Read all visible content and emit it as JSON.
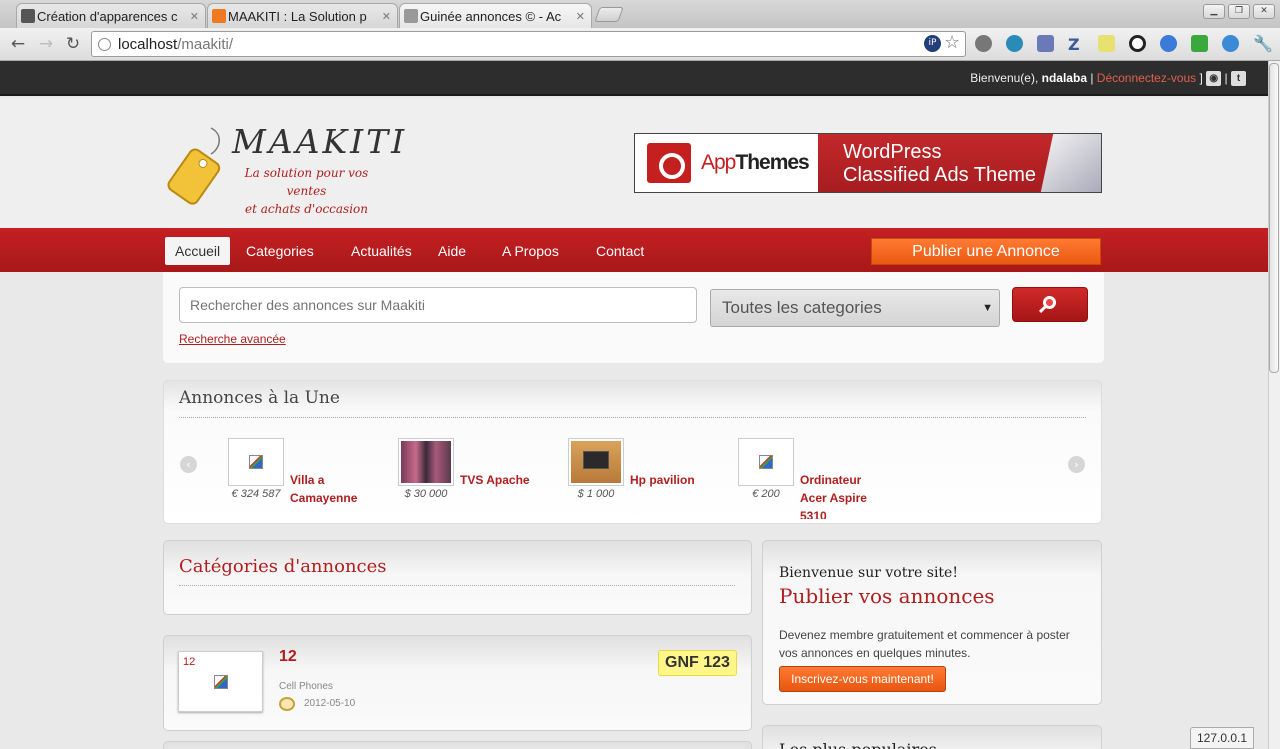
{
  "browser": {
    "tabs": [
      {
        "title": "Création d'apparences c",
        "color": "#555555"
      },
      {
        "title": "MAAKITI : La Solution p",
        "color": "#f07a20"
      },
      {
        "title": "Guinée annonces © - Ac",
        "color": "#999999"
      }
    ],
    "url_host": "localhost",
    "url_path": "/maakiti/"
  },
  "topbar": {
    "welcome": "Bienvenu(e),",
    "username": "ndalaba",
    "sep_open": " | ",
    "logout": "Déconnectez-vous",
    "sep_close": " ] ",
    "divider": " | "
  },
  "logo": {
    "title": "MAAKITI",
    "tagline_1": "La solution pour vos ventes",
    "tagline_2": "et achats d'occasion"
  },
  "banner": {
    "brand_a": "App",
    "brand_b": "Themes",
    "line1": "WordPress",
    "line2": "Classified Ads Theme"
  },
  "nav": {
    "items": [
      "Accueil",
      "Categories",
      "Actualités",
      "Aide",
      "A Propos",
      "Contact"
    ],
    "publish": "Publier une Annonce"
  },
  "search": {
    "placeholder": "Rechercher des annonces sur Maakiti",
    "category": "Toutes les categories",
    "advanced": "Recherche avancée"
  },
  "featured": {
    "title": "Annonces à la Une",
    "items": [
      {
        "title": "Villa  a Camayenne",
        "price": "€ 324 587"
      },
      {
        "title": "TVS Apache",
        "price": "$ 30 000"
      },
      {
        "title": "Hp pavilion",
        "price": "$ 1 000"
      },
      {
        "title": "Ordinateur Acer Aspire 5310",
        "price": "€ 200"
      }
    ]
  },
  "categories": {
    "title": "Catégories d'annonces"
  },
  "listing": {
    "thumb_alt": "12",
    "title": "12",
    "category": "Cell Phones",
    "date": "2012-05-10",
    "price": "GNF 123"
  },
  "sidebar": {
    "hello": "Bienvenue sur votre site!",
    "heading": "Publier vos annonces",
    "text": "Devenez membre gratuitement et commencer à poster vos annonces en quelques minutes.",
    "button": "Inscrivez-vous maintenant!",
    "next_heading": "Les plus populaires"
  },
  "status": "127.0.0.1",
  "colors": {
    "brand_red": "#b01e1e",
    "accent_orange": "#f06a20",
    "price_tag": "#fff68a"
  }
}
